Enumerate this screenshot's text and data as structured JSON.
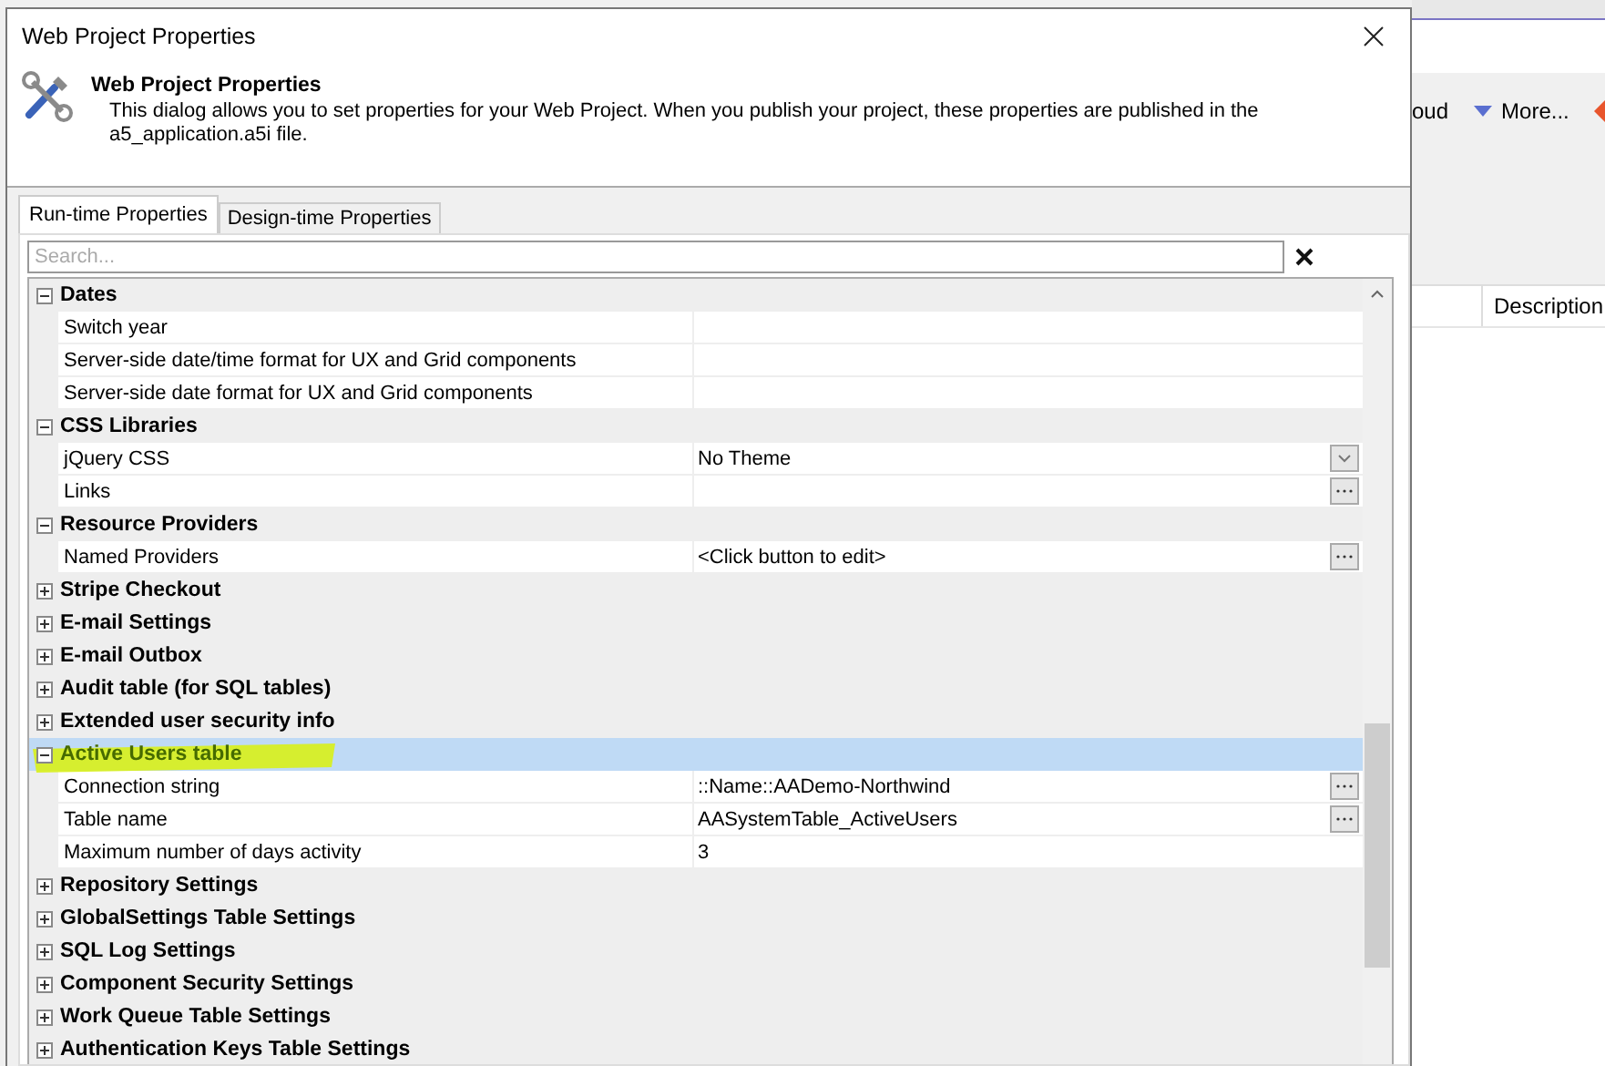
{
  "background_app": {
    "toolbar": [
      {
        "kind": "text",
        "label": "oud"
      },
      {
        "kind": "menu",
        "label": "More..."
      },
      {
        "kind": "icon"
      }
    ],
    "column_header": "Description"
  },
  "window": {
    "title": "Web Project Properties"
  },
  "header": {
    "title": "Web Project Properties",
    "description": "This dialog allows you to set properties for your Web Project. When you publish your project, these properties are published in the a5_application.a5i file."
  },
  "tabs": [
    {
      "label": "Run-time Properties",
      "selected": true
    },
    {
      "label": "Design-time Properties",
      "selected": false
    }
  ],
  "search": {
    "placeholder": "Search..."
  },
  "groups": [
    {
      "label": "Dates",
      "expanded": true,
      "selected": false,
      "marked": false,
      "children": [
        {
          "label": "Switch year",
          "kind": "plain"
        },
        {
          "label": "Server-side date/time format for UX and Grid components",
          "kind": "plain"
        },
        {
          "label": "Server-side date format for UX and Grid components",
          "kind": "plain"
        }
      ]
    },
    {
      "label": "CSS Libraries",
      "expanded": true,
      "selected": false,
      "marked": false,
      "children": [
        {
          "label": "jQuery CSS",
          "value": "No Theme",
          "kind": "dropdown"
        },
        {
          "label": "Links",
          "kind": "ellipsis"
        }
      ]
    },
    {
      "label": "Resource Providers",
      "expanded": true,
      "selected": false,
      "marked": false,
      "children": [
        {
          "label": "Named Providers",
          "value": "<Click button to edit>",
          "kind": "ellipsis"
        }
      ]
    },
    {
      "label": "Stripe Checkout",
      "expanded": false,
      "selected": false,
      "marked": false
    },
    {
      "label": "E-mail Settings",
      "expanded": false,
      "selected": false,
      "marked": false
    },
    {
      "label": "E-mail Outbox",
      "expanded": false,
      "selected": false,
      "marked": false
    },
    {
      "label": "Audit table (for SQL tables)",
      "expanded": false,
      "selected": false,
      "marked": false
    },
    {
      "label": "Extended user security info",
      "expanded": false,
      "selected": false,
      "marked": false
    },
    {
      "label": "Active Users table",
      "expanded": true,
      "selected": true,
      "marked": true,
      "children": [
        {
          "label": "Connection string",
          "value": "::Name::AADemo-Northwind",
          "kind": "ellipsis"
        },
        {
          "label": "Table name",
          "value": "AASystemTable_ActiveUsers",
          "kind": "ellipsis"
        },
        {
          "label": "Maximum number of days activity",
          "value": "3",
          "kind": "plain"
        }
      ]
    },
    {
      "label": "Repository Settings",
      "expanded": false,
      "selected": false,
      "marked": false
    },
    {
      "label": "GlobalSettings Table Settings",
      "expanded": false,
      "selected": false,
      "marked": false
    },
    {
      "label": "SQL Log Settings",
      "expanded": false,
      "selected": false,
      "marked": false
    },
    {
      "label": "Component Security Settings",
      "expanded": false,
      "selected": false,
      "marked": false
    },
    {
      "label": "Work Queue Table Settings",
      "expanded": false,
      "selected": false,
      "marked": false
    },
    {
      "label": "Authentication Keys Table Settings",
      "expanded": false,
      "selected": false,
      "marked": false
    }
  ]
}
